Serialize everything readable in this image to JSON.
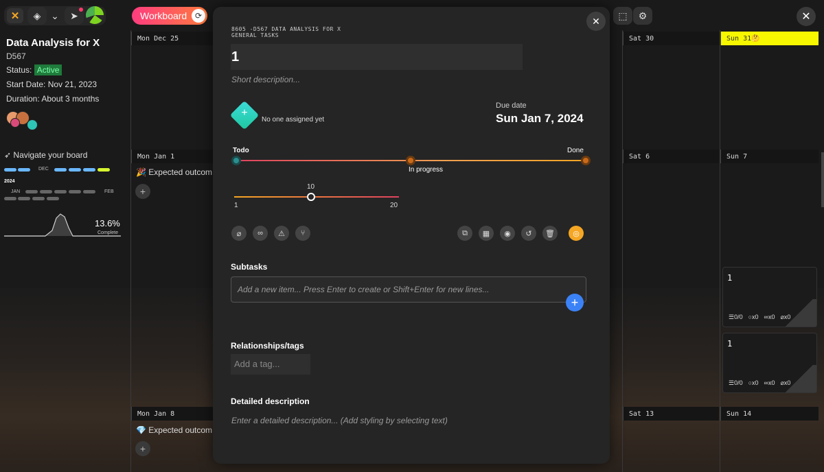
{
  "topbar": {
    "workboard_label": "Workboard",
    "close_label": "✕"
  },
  "project": {
    "title": "Data Analysis for X",
    "code": "D567",
    "status_label": "Status:",
    "status_value": "Active",
    "start_date": "Start Date: Nov 21, 2023",
    "duration": "Duration: About 3 months",
    "navigate_label": "Navigate your board",
    "minimap": {
      "month_dec": "DEC",
      "year": "2024",
      "month_jan": "JAN",
      "month_feb": "FEB"
    },
    "progress_percent": "13.6%",
    "progress_label": "Complete"
  },
  "calendar": {
    "week1": [
      "Mon Dec 25",
      "Sat 30",
      "Sun 31🤔"
    ],
    "week2": [
      "Mon Jan 1",
      "Sat 6",
      "Sun 7"
    ],
    "week3": [
      "Mon Jan 8",
      "Sat 13",
      "Sun 14"
    ],
    "expected_1": "🎉 Expected outcom",
    "expected_2": "💎 Expected outcom",
    "highlight_color": "#f7f700"
  },
  "cards": [
    {
      "title": "1",
      "checklist": "0/0",
      "comments": "x0",
      "links": "x0",
      "attachments": "x0"
    },
    {
      "title": "1",
      "checklist": "0/0",
      "comments": "x0",
      "links": "x0",
      "attachments": "x0"
    }
  ],
  "modal": {
    "crumb_line1": "8605 -D567 DATA ANALYSIS FOR X",
    "crumb_line2": "GENERAL TASKS",
    "title": "1",
    "short_desc_placeholder": "Short description...",
    "assignee_text": "No one assigned yet",
    "due_label": "Due date",
    "due_value": "Sun Jan 7, 2024",
    "stages": {
      "todo": "Todo",
      "in_progress": "In progress",
      "done": "Done",
      "current": "Todo"
    },
    "slider": {
      "min": "1",
      "max": "20",
      "value": "10",
      "value_fraction": 0.47
    },
    "subtasks_label": "Subtasks",
    "subtasks_placeholder": "Add a new item... Press Enter to create or Shift+Enter for new lines...",
    "tags_label": "Relationships/tags",
    "tag_placeholder": "Add a tag...",
    "desc_label": "Detailed description",
    "desc_placeholder": "Enter a detailed description... (Add styling by selecting text)",
    "accent_color": "#f5a623"
  }
}
